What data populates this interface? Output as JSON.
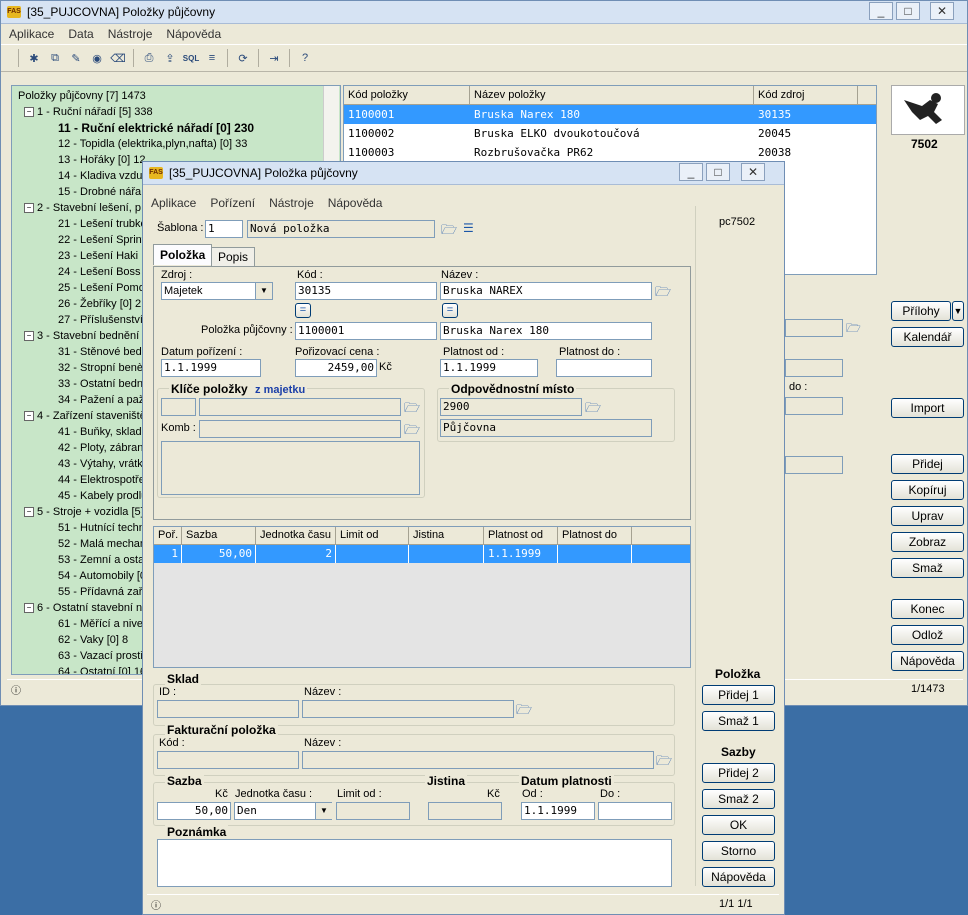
{
  "main": {
    "title": "[35_PUJCOVNA] Položky půjčovny",
    "menu": [
      "Aplikace",
      "Data",
      "Nástroje",
      "Nápověda"
    ],
    "tree": [
      {
        "label": "Položky půjčovny [7] 1473",
        "level": 0,
        "bold": false
      },
      {
        "label": "1 - Ruční nářadí [5] 338",
        "level": 1,
        "bold": false
      },
      {
        "label": "11 - Ruční elektrické nářadí [0] 230",
        "level": 2,
        "bold": true
      },
      {
        "label": "12 - Topidla (elektrika,plyn,nafta) [0] 33",
        "level": 2,
        "bold": false
      },
      {
        "label": "13 - Hořáky [0] 12",
        "level": 2,
        "bold": false
      },
      {
        "label": "14 - Kladiva vzdu",
        "level": 2,
        "bold": false
      },
      {
        "label": "15 - Drobné nářa",
        "level": 2,
        "bold": false
      },
      {
        "label": "2 - Stavební lešení, p",
        "level": 1,
        "bold": false
      },
      {
        "label": "21 - Lešení trubko",
        "level": 2,
        "bold": false
      },
      {
        "label": "22 - Lešení Sprint",
        "level": 2,
        "bold": false
      },
      {
        "label": "23 - Lešení Haki",
        "level": 2,
        "bold": false
      },
      {
        "label": "24 - Lešení Boss",
        "level": 2,
        "bold": false
      },
      {
        "label": "25 - Lešení Pomo",
        "level": 2,
        "bold": false
      },
      {
        "label": "26 - Žebříky [0] 2",
        "level": 2,
        "bold": false
      },
      {
        "label": "27 - Příslušenství",
        "level": 2,
        "bold": false
      },
      {
        "label": "3 - Stavební bednění",
        "level": 1,
        "bold": false
      },
      {
        "label": "31 - Stěnové bed",
        "level": 2,
        "bold": false
      },
      {
        "label": "32 - Stropní benè",
        "level": 2,
        "bold": false
      },
      {
        "label": "33 - Ostatní bedn",
        "level": 2,
        "bold": false
      },
      {
        "label": "34 - Pažení a paž",
        "level": 2,
        "bold": false
      },
      {
        "label": "4 - Zařízení staveniště",
        "level": 1,
        "bold": false
      },
      {
        "label": "41 - Buňky, sklad",
        "level": 2,
        "bold": false
      },
      {
        "label": "42 - Ploty, zábran",
        "level": 2,
        "bold": false
      },
      {
        "label": "43 - Výtahy, vrátk",
        "level": 2,
        "bold": false
      },
      {
        "label": "44 - Elektrospotře",
        "level": 2,
        "bold": false
      },
      {
        "label": "45 - Kabely prodlu",
        "level": 2,
        "bold": false
      },
      {
        "label": "5 - Stroje + vozidla [5]",
        "level": 1,
        "bold": false
      },
      {
        "label": "51 - Hutnící techn",
        "level": 2,
        "bold": false
      },
      {
        "label": "52 - Malá mechan",
        "level": 2,
        "bold": false
      },
      {
        "label": "53 - Zemní a osta",
        "level": 2,
        "bold": false
      },
      {
        "label": "54 - Automobily [0",
        "level": 2,
        "bold": false
      },
      {
        "label": "55 - Přídavná zař",
        "level": 2,
        "bold": false
      },
      {
        "label": "6 - Ostatní stavební n",
        "level": 1,
        "bold": false
      },
      {
        "label": "61 - Měřící a nive",
        "level": 2,
        "bold": false
      },
      {
        "label": "62 - Vaky [0] 8",
        "level": 2,
        "bold": false
      },
      {
        "label": "63 - Vazací prostř",
        "level": 2,
        "bold": false
      },
      {
        "label": "64 - Ostatní [0] 16",
        "level": 2,
        "bold": false
      }
    ],
    "grid_headers": [
      "Kód položky",
      "Název položky",
      "Kód zdroj"
    ],
    "grid_rows": [
      [
        "1100001",
        "Bruska Narex 180",
        "30135"
      ],
      [
        "1100002",
        "Bruska ELKO dvoukotoučová",
        "20045"
      ],
      [
        "1100003",
        "Rozbrušovačka PR62",
        "20038"
      ]
    ],
    "item_number": "7502",
    "buttons": [
      "Přílohy",
      "Kalendář",
      "Import",
      "Přidej",
      "Kopíruj",
      "Uprav",
      "Zobraz",
      "Smaž",
      "Konec",
      "Odlož",
      "Nápověda"
    ],
    "status_right": "1/1473",
    "behind_label": "do :"
  },
  "dialog": {
    "title": "[35_PUJCOVNA] Položka půjčovny",
    "menu": [
      "Aplikace",
      "Pořízení",
      "Nástroje",
      "Nápověda"
    ],
    "pc": "pc7502",
    "sablona_label": "Šablona :",
    "sablona_value": "1",
    "sablona_text": "Nová položka",
    "tabs": [
      "Položka",
      "Popis"
    ],
    "zdroj_label": "Zdroj :",
    "zdroj_value": "Majetek",
    "kod_label": "Kód :",
    "kod_value": "30135",
    "nazev_label": "Název :",
    "nazev_value": "Bruska NAREX",
    "eq": "=",
    "polozka_label": "Položka půjčovny :",
    "polozka_value": "1100001",
    "polozka_nazev": "Bruska Narex 180",
    "datum_label": "Datum pořízení :",
    "datum_value": "1.1.1999",
    "cena_label": "Pořizovací cena :",
    "cena_value": "2459,00",
    "currency": "Kč",
    "platnost_od_label": "Platnost od :",
    "platnost_od_value": "1.1.1999",
    "platnost_do_label": "Platnost do :",
    "klice_title": "Klíče položky",
    "klice_sub": "z majetku",
    "komb_label": "Komb :",
    "odpov_title": "Odpovědnostní místo",
    "odpov_code": "2900",
    "odpov_name": "Půjčovna",
    "rate_headers": [
      "Poř.",
      "Sazba",
      "Jednotka času",
      "Limit od",
      "Jistina",
      "Platnost od",
      "Platnost do"
    ],
    "rate_row": [
      "1",
      "50,00",
      "2",
      "",
      "",
      "1.1.1999",
      ""
    ],
    "sklad_title": "Sklad",
    "id_label": "ID :",
    "nazev2_label": "Název :",
    "fakt_title": "Fakturační položka",
    "kod2_label": "Kód :",
    "sazba_title": "Sazba",
    "jistina_title": "Jistina",
    "datum_platnosti_title": "Datum platnosti",
    "jednotka_label": "Jednotka času :",
    "jednotka_value": "Den",
    "limit_label": "Limit od :",
    "od_label": "Od :",
    "do_label": "Do :",
    "sazba_value": "50,00",
    "od_value": "1.1.1999",
    "poznamka_title": "Poznámka",
    "side_polozka": "Položka",
    "side_sazby": "Sazby",
    "btn_pridej1": "Přidej 1",
    "btn_smaz1": "Smaž 1",
    "btn_pridej2": "Přidej 2",
    "btn_smaz2": "Smaž 2",
    "btn_ok": "OK",
    "btn_storno": "Storno",
    "btn_napoveda": "Nápověda",
    "status_right": "1/1  1/1"
  }
}
